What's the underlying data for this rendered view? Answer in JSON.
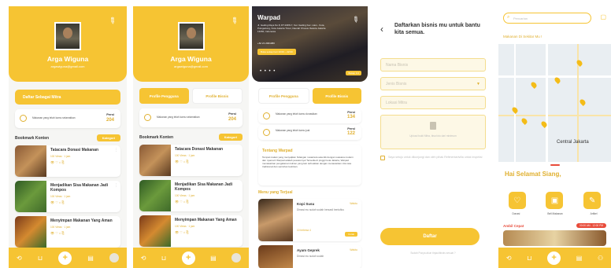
{
  "profile": {
    "name": "Arga Wiguna",
    "email": "argawiguna@gmail.com"
  },
  "mitra_button": "Daftar Sebagai Mitra",
  "tabs": {
    "user": "Profile Pengguna",
    "business": "Profile Bisnis"
  },
  "stat1": {
    "text": "Makanan yang telah kamu selamatkan",
    "label": "Persi",
    "value": "204"
  },
  "stat2a": {
    "text": "Makanan yang telah kamu donasikan",
    "label": "Persi",
    "value": "134"
  },
  "stat2b": {
    "text": "Makanan yang telah kamu jual",
    "label": "Persi",
    "value": "122"
  },
  "bookmark": {
    "title": "Bookmark Konten",
    "category": "Kategori",
    "items": [
      {
        "title": "Tatacara Donasi Makanan",
        "views": "100 Views · 1 jam",
        "icons": "👁 ♡ ⌂ ⎘"
      },
      {
        "title": "Menjadikan Sisa Makanan Jadi Kompos",
        "views": "100 Views · 1 jam",
        "icons": "👁 ♡ ⌂ ⎘"
      },
      {
        "title": "Menyimpan Makanan Yang Aman",
        "views": "100 Views · 1 jam",
        "icons": "👁 ♡ ⌂ ⎘"
      }
    ]
  },
  "cafe": {
    "name": "Warpad",
    "address": "Jl. Gading Raya No.8, RT.1/RW.7, Kel. Gading Kec. Ham.. Kota, Pulogadung, Kota Jakarta Timur, Daerah Khusus Ibukota Jakarta 13260, Indonesia",
    "phone": "+62 21 2001080",
    "hours": "Buka setiap hari 10:00 – 22:00",
    "dots": "• • • •",
    "badge": "Bukap 3.2"
  },
  "about": {
    "title": "Tentang Warpad",
    "text": "Tempat makan yang menyajikan hidangan nusantara autentik dengan suasana modern dan nyaman! Warpad adalah pesatonnya! Tersedia di pinggir kota Jakarta, Warpad menawarkan pengalaman kuliner yang lain terbuatkan dengan menawarkan cita rasa tradisional dan sentuhan kekinian."
  },
  "menu": {
    "title": "Menu yang Terjual",
    "items": [
      {
        "name": "Kopi Susu",
        "desc": "Dimasi mu sudah sudah bersasil bentuflus",
        "sold": "10 terbesa 4",
        "price": "Waktu",
        "button": "Kotak"
      },
      {
        "name": "Ayam Geprek",
        "desc": "Dimasi mu sudah sudah",
        "sold": "",
        "price": "Waktu",
        "button": ""
      }
    ]
  },
  "register": {
    "title": "Daftarkan bisnis mu untuk bantu kita semua.",
    "name": "Nama Bisnis",
    "type": "Jenis Bisnis",
    "location": "Lokasi Mitra",
    "upload": "Upload bukti Mitra, bisa foto dari minimum",
    "agree": "Saya setuju untuk dikunjungi dan oleh pihak Refimentarivilia untuk inspeksi",
    "button": "Daftar",
    "footer": "Sudah Punya akun tinjau/bisnis sesuai ?"
  },
  "home": {
    "search": "Pencarian",
    "nearby": "Makanan Di Sekitar Mu !",
    "city": "Central Jakarta",
    "greeting": "Hai Selamat Siang,",
    "cats": [
      "Donasi",
      "Beli Makanan",
      "Artikel"
    ],
    "quick": "Ambil Cepat",
    "time": "00:00 AM - 12:00 PM"
  },
  "nav": {
    "icons": [
      "history-icon",
      "cart-icon",
      "plus-icon",
      "store-icon",
      "avatar-icon"
    ]
  }
}
